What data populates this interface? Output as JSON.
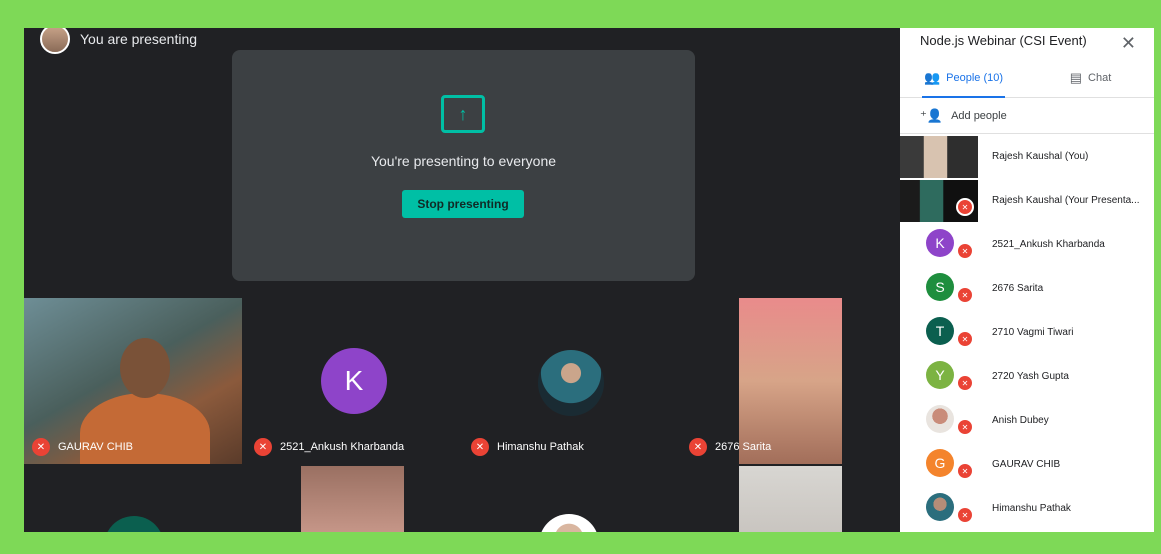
{
  "stage": {
    "presenting_label": "You are presenting",
    "present_message": "You're presenting to everyone",
    "stop_button": "Stop presenting",
    "tiles": [
      {
        "name": "GAURAV CHIB"
      },
      {
        "name": "2521_Ankush Kharbanda",
        "initial": "K"
      },
      {
        "name": "Himanshu Pathak"
      },
      {
        "name": "2676 Sarita"
      }
    ]
  },
  "panel": {
    "title": "Node.js Webinar (CSI Event)",
    "close_icon": "✕",
    "tabs": [
      {
        "label": "People (10)",
        "icon": "people-icon"
      },
      {
        "label": "Chat",
        "icon": "chat-icon"
      }
    ],
    "add_people": "Add people",
    "people": [
      {
        "name": "Rajesh Kaushal (You)"
      },
      {
        "name": "Rajesh Kaushal (Your Presenta..."
      },
      {
        "name": "2521_Ankush Kharbanda",
        "initial": "K",
        "color": "#8e44c9"
      },
      {
        "name": "2676 Sarita",
        "initial": "S",
        "color": "#1e8e3e"
      },
      {
        "name": "2710 Vagmi Tiwari",
        "initial": "T",
        "color": "#0b5f4f"
      },
      {
        "name": "2720 Yash Gupta",
        "initial": "Y",
        "color": "#7cb342"
      },
      {
        "name": "Anish Dubey"
      },
      {
        "name": "GAURAV CHIB",
        "initial": "G",
        "color": "#f4842c"
      },
      {
        "name": "Himanshu Pathak"
      }
    ]
  },
  "colors": {
    "accent": "#00bfa5",
    "tab_active": "#1a73e8",
    "mute": "#ea4335"
  }
}
